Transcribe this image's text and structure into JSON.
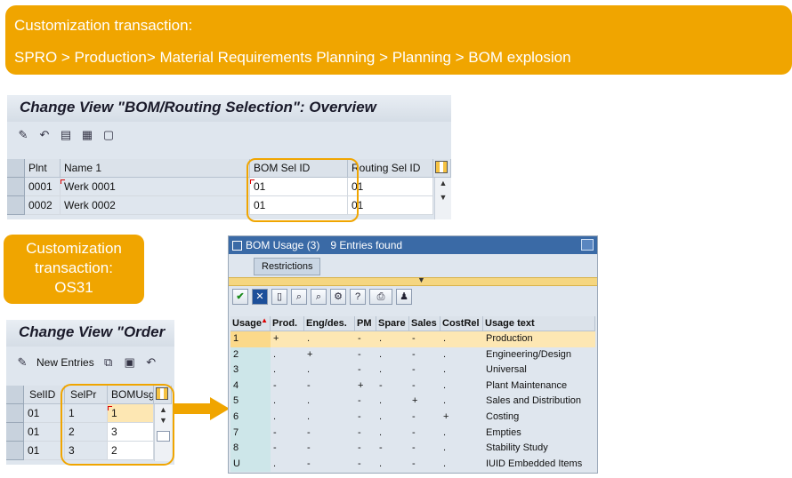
{
  "callout_top": {
    "line1": "Customization transaction:",
    "line2": "SPRO > Production> Material Requirements Planning > Planning > BOM explosion"
  },
  "panel1": {
    "title": "Change View \"BOM/Routing Selection\": Overview",
    "columns": [
      "Plnt",
      "Name 1",
      "BOM Sel ID",
      "Routing Sel ID"
    ],
    "rows": [
      {
        "plnt": "0001",
        "name": "Werk 0001",
        "bom": "01",
        "routing": "01"
      },
      {
        "plnt": "0002",
        "name": "Werk 0002",
        "bom": "01",
        "routing": "01"
      }
    ]
  },
  "callout2": {
    "line1": "Customization",
    "line2": "transaction:",
    "line3": "OS31"
  },
  "panel2": {
    "title": "Change View \"Order",
    "new_entries": "New Entries",
    "columns": [
      "SelID",
      "SelPr",
      "BOMUsg"
    ],
    "rows": [
      {
        "selid": "01",
        "selpr": "1",
        "bomusg": "1"
      },
      {
        "selid": "01",
        "selpr": "2",
        "bomusg": "3"
      },
      {
        "selid": "01",
        "selpr": "3",
        "bomusg": "2"
      }
    ]
  },
  "panel3": {
    "title": "BOM Usage (3)",
    "found": "9 Entries found",
    "tab": "Restrictions",
    "columns": [
      "Usage",
      "Prod.",
      "Eng/des.",
      "PM",
      "Spare",
      "Sales",
      "CostRel",
      "Usage text"
    ],
    "rows": [
      [
        "1",
        "+",
        ".",
        "-",
        ".",
        "-",
        ".",
        "Production"
      ],
      [
        "2",
        ".",
        "+",
        "-",
        ".",
        "-",
        ".",
        "Engineering/Design"
      ],
      [
        "3",
        ".",
        ".",
        "-",
        ".",
        "-",
        ".",
        "Universal"
      ],
      [
        "4",
        "-",
        "-",
        "+",
        "-",
        "-",
        ".",
        "Plant Maintenance"
      ],
      [
        "5",
        ".",
        ".",
        "-",
        ".",
        "+",
        ".",
        "Sales and Distribution"
      ],
      [
        "6",
        ".",
        ".",
        "-",
        ".",
        "-",
        "+",
        "Costing"
      ],
      [
        "7",
        "-",
        "-",
        "-",
        ".",
        "-",
        ".",
        "Empties"
      ],
      [
        "8",
        "-",
        "-",
        "-",
        "-",
        "-",
        ".",
        "Stability Study"
      ],
      [
        "U",
        ".",
        "-",
        "-",
        ".",
        "-",
        ".",
        "IUID Embedded Items"
      ]
    ]
  },
  "colors": {
    "accent": "#f0a500",
    "sap_blue": "#3a6aa6"
  }
}
